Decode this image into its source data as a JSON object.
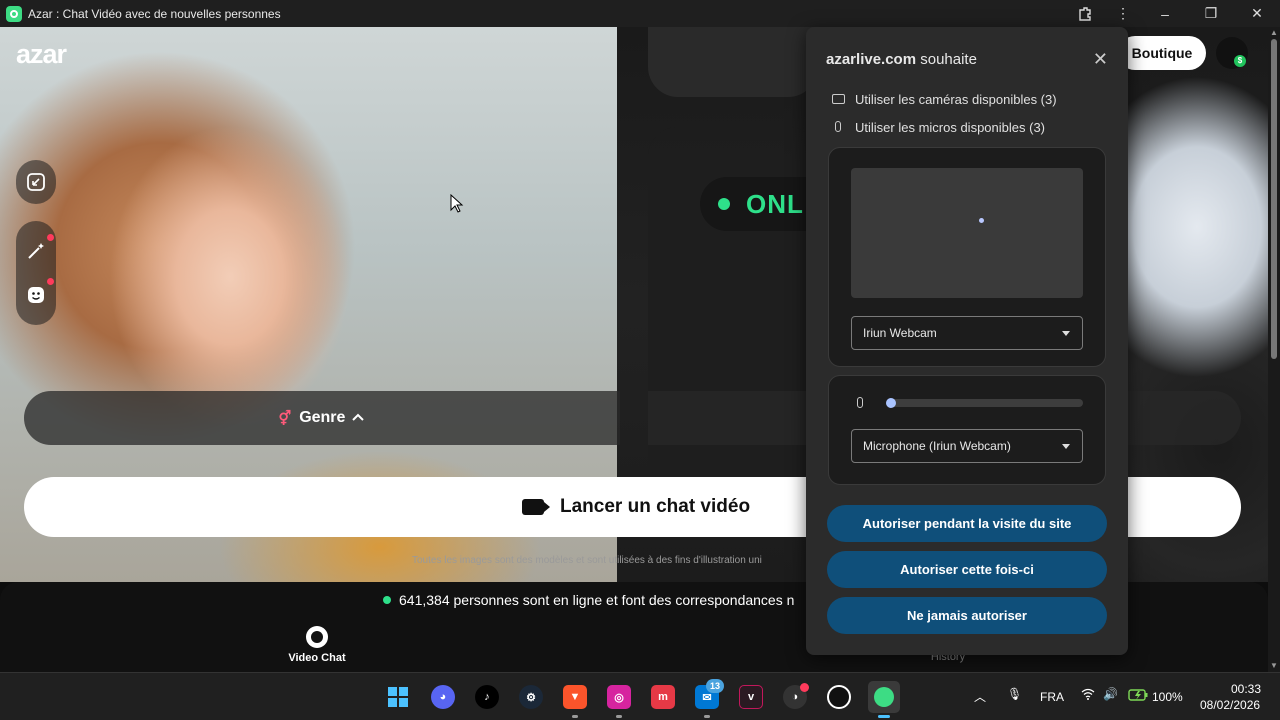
{
  "window": {
    "title": "Azar : Chat Vidéo avec de nouvelles personnes"
  },
  "site": {
    "logo": "azar",
    "shop_label": "Boutique",
    "online_tag": "ONL",
    "genre_label": "Genre",
    "launch_label": "Lancer un chat vidéo",
    "disclaimer": "Toutes les images sont des modèles et sont utilisées à des fins d'illustration uni",
    "online_count_text": "641,384 personnes sont en ligne et font des correspondances n",
    "nav": {
      "video_chat": "Video Chat",
      "history": "History"
    }
  },
  "permission": {
    "origin": "azarlive.com",
    "request_suffix": "souhaite",
    "camera_text": "Utiliser les caméras disponibles (3)",
    "mic_text": "Utiliser les micros disponibles (3)",
    "camera_select": "Iriun Webcam",
    "mic_select": "Microphone (Iriun Webcam)",
    "buttons": {
      "allow_visit": "Autoriser pendant la visite du site",
      "allow_once": "Autoriser cette fois-ci",
      "never": "Ne jamais autoriser"
    }
  },
  "taskbar": {
    "notification_count": "13",
    "language": "FRA",
    "battery": "100%",
    "time": "00:33",
    "date": "08/02/2026"
  },
  "colors": {
    "accent_green": "#2ee08a",
    "perm_button": "#0f4f7a",
    "red_badge": "#ff3b5c"
  }
}
